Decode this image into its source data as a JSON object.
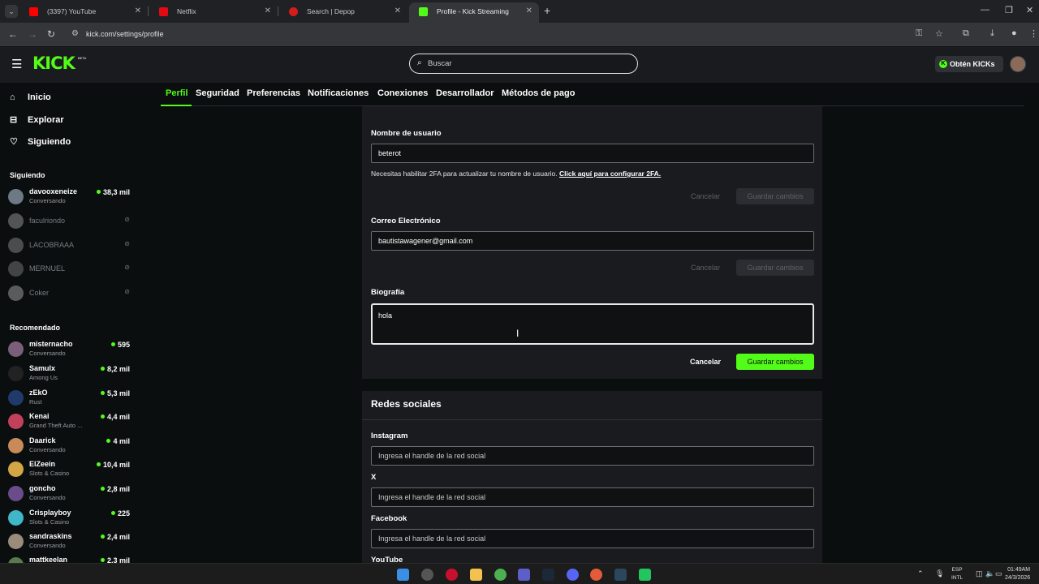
{
  "browser": {
    "tabs": [
      {
        "title": "(3397) YouTube",
        "color": "#ff0000"
      },
      {
        "title": "Netflix",
        "color": "#e50914"
      },
      {
        "title": "Search | Depop",
        "color": "#ff2300"
      },
      {
        "title": "Profile - Kick Streaming",
        "color": "#53fc18"
      }
    ],
    "url": "kick.com/settings/profile"
  },
  "header": {
    "logo": "KICK",
    "logo_sup": "BETA",
    "search_placeholder": "Buscar",
    "kicks_button": "Obtén KICKs"
  },
  "sidebar": {
    "nav": [
      {
        "label": "Inicio",
        "icon": "home-icon"
      },
      {
        "label": "Explorar",
        "icon": "compass-icon"
      },
      {
        "label": "Siguiendo",
        "icon": "heart-icon"
      }
    ],
    "following_title": "Siguiendo",
    "following": [
      {
        "name": "davooxeneize",
        "category": "Conversando",
        "viewers": "38,3 mil",
        "live": true
      },
      {
        "name": "faculriondo",
        "live": false
      },
      {
        "name": "LACOBRAAA",
        "live": false
      },
      {
        "name": "MERNUEL",
        "live": false
      },
      {
        "name": "Coker",
        "live": false
      }
    ],
    "recommended_title": "Recomendado",
    "recommended": [
      {
        "name": "misternacho",
        "category": "Conversando",
        "viewers": "595"
      },
      {
        "name": "Samulx",
        "category": "Among Us",
        "viewers": "8,2 mil"
      },
      {
        "name": "zEkO",
        "category": "Rust",
        "viewers": "5,3 mil"
      },
      {
        "name": "Kenai",
        "category": "Grand Theft Auto ...",
        "viewers": "4,4 mil"
      },
      {
        "name": "Daarick",
        "category": "Conversando",
        "viewers": "4 mil"
      },
      {
        "name": "ElZeein",
        "category": "Slots & Casino",
        "viewers": "10,4 mil"
      },
      {
        "name": "goncho",
        "category": "Conversando",
        "viewers": "2,8 mil"
      },
      {
        "name": "Crisplayboy",
        "category": "Slots & Casino",
        "viewers": "225"
      },
      {
        "name": "sandraskins",
        "category": "Conversando",
        "viewers": "2,4 mil"
      },
      {
        "name": "mattkeelan",
        "category": "",
        "viewers": "2,3 mil"
      }
    ]
  },
  "settings_tabs": [
    "Perfil",
    "Seguridad",
    "Preferencias",
    "Notificaciones",
    "Conexiones",
    "Desarrollador",
    "Métodos de pago"
  ],
  "profile": {
    "username_label": "Nombre de usuario",
    "username_value": "beterot",
    "username_hint": "Necesitas habilitar 2FA para actualizar tu nombre de usuario.",
    "username_hint_link": "Click aquí para configurar 2FA.",
    "email_label": "Correo Electrónico",
    "email_value": "bautistawagener@gmail.com",
    "bio_label": "Biografía",
    "bio_value": "hola",
    "cancel": "Cancelar",
    "save": "Guardar cambios"
  },
  "social": {
    "title": "Redes sociales",
    "placeholder": "Ingresa el handle de la red social",
    "fields": [
      "Instagram",
      "X",
      "Facebook",
      "YouTube"
    ]
  },
  "system": {
    "lang_1": "ESP",
    "lang_2": "INTL",
    "time": "01:49AM",
    "date": "24/3/2026"
  },
  "colors": {
    "accent": "#53fc18",
    "panel": "#191b1f",
    "background": "#0b0e0f"
  }
}
